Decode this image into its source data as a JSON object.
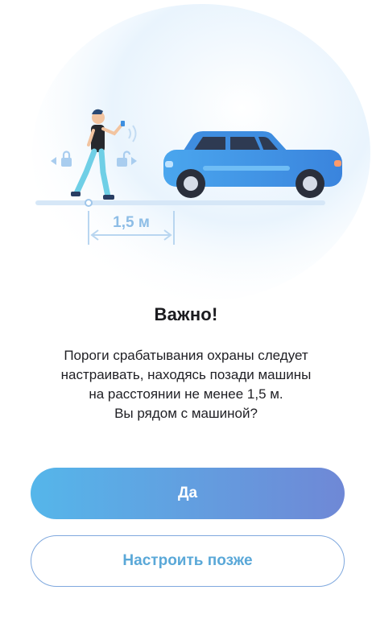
{
  "illustration": {
    "distance_label": "1,5 м"
  },
  "dialog": {
    "title": "Важно!",
    "message_lines": [
      "Пороги срабатывания охраны следует",
      "настраивать, находясь позади машины",
      "на расстоянии не менее 1,5 м.",
      "Вы рядом с машиной?"
    ]
  },
  "buttons": {
    "primary_label": "Да",
    "secondary_label": "Настроить позже"
  },
  "colors": {
    "primary_gradient_start": "#55b6ea",
    "primary_gradient_end": "#6f88d6",
    "secondary_text": "#5aa8d8",
    "car_body": "#3d8fe0",
    "halo": "#e6f3fc"
  },
  "icons": [
    "lock-icon",
    "unlock-icon",
    "car-illustration",
    "person-illustration"
  ]
}
